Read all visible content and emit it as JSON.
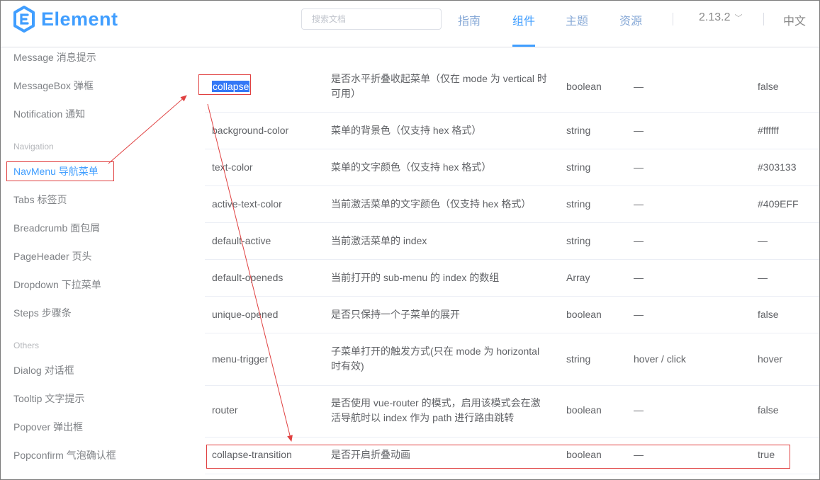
{
  "header": {
    "logo_text": "Element",
    "search_placeholder": "搜索文档",
    "nav": [
      "指南",
      "组件",
      "主题",
      "资源"
    ],
    "active_nav": "组件",
    "version": "2.13.2",
    "language": "中文"
  },
  "sidebar": {
    "items_top": [
      "Message 消息提示",
      "MessageBox 弹框",
      "Notification 通知"
    ],
    "group_navigation": "Navigation",
    "items_navigation": [
      "NavMenu 导航菜单",
      "Tabs 标签页",
      "Breadcrumb 面包屑",
      "PageHeader 页头",
      "Dropdown 下拉菜单",
      "Steps 步骤条"
    ],
    "group_others": "Others",
    "items_others": [
      "Dialog 对话框",
      "Tooltip 文字提示",
      "Popover 弹出框",
      "Popconfirm 气泡确认框"
    ]
  },
  "table": {
    "rows": [
      {
        "param": "collapse",
        "desc": "是否水平折叠收起菜单（仅在 mode 为 vertical 时可用）",
        "type": "boolean",
        "options": "—",
        "default": "false"
      },
      {
        "param": "background-color",
        "desc": "菜单的背景色（仅支持 hex 格式）",
        "type": "string",
        "options": "—",
        "default": "#ffffff"
      },
      {
        "param": "text-color",
        "desc": "菜单的文字颜色（仅支持 hex 格式）",
        "type": "string",
        "options": "—",
        "default": "#303133"
      },
      {
        "param": "active-text-color",
        "desc": "当前激活菜单的文字颜色（仅支持 hex 格式）",
        "type": "string",
        "options": "—",
        "default": "#409EFF"
      },
      {
        "param": "default-active",
        "desc": "当前激活菜单的 index",
        "type": "string",
        "options": "—",
        "default": "—"
      },
      {
        "param": "default-openeds",
        "desc": "当前打开的 sub-menu 的 index 的数组",
        "type": "Array",
        "options": "—",
        "default": "—"
      },
      {
        "param": "unique-opened",
        "desc": "是否只保持一个子菜单的展开",
        "type": "boolean",
        "options": "—",
        "default": "false"
      },
      {
        "param": "menu-trigger",
        "desc": "子菜单打开的触发方式(只在 mode 为 horizontal 时有效)",
        "type": "string",
        "options": "hover / click",
        "default": "hover"
      },
      {
        "param": "router",
        "desc": "是否使用 vue-router 的模式，启用该模式会在激活导航时以 index 作为 path 进行路由跳转",
        "type": "boolean",
        "options": "—",
        "default": "false"
      },
      {
        "param": "collapse-transition",
        "desc": "是否开启折叠动画",
        "type": "boolean",
        "options": "—",
        "default": "true"
      }
    ]
  },
  "colors": {
    "brand": "#409EFF",
    "annotation": "#e04040",
    "selection": "#3478f6"
  }
}
